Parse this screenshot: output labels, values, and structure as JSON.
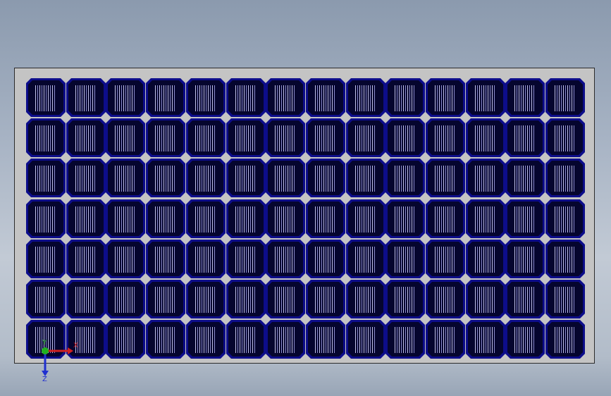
{
  "model": {
    "rows": 7,
    "columns": 14,
    "panel_color": "#c4c4c4",
    "cell_color": "#0d0d8a",
    "cell_inner_color": "#05052e"
  },
  "triad": {
    "x_label": "X",
    "y_label": "Y",
    "z_label": "Z",
    "x_color": "#d02020",
    "y_color": "#20b020",
    "z_color": "#2030d0"
  }
}
